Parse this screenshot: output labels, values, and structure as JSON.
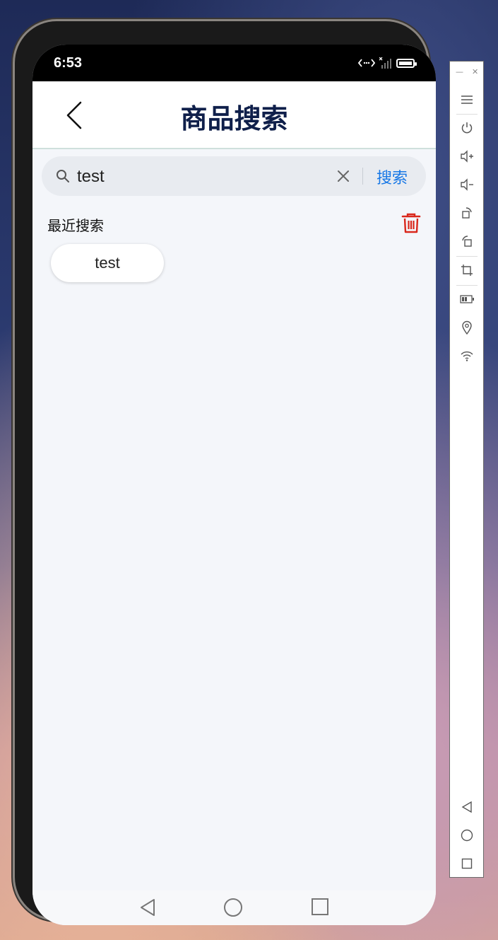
{
  "status_bar": {
    "time": "6:53"
  },
  "header": {
    "title": "商品搜索"
  },
  "search": {
    "value": "test",
    "button_label": "搜索"
  },
  "recent": {
    "label": "最近搜索",
    "items": [
      "test"
    ]
  },
  "icons": {
    "back": "chevron-left-icon",
    "search": "search-icon",
    "clear": "close-icon",
    "delete": "trash-icon"
  },
  "colors": {
    "title": "#0f1f4a",
    "accent": "#1677e6",
    "delete": "#d9281c",
    "background": "#f4f6fa"
  },
  "emulator_toolbar": {
    "window_controls": [
      "minimize",
      "close"
    ],
    "tools": [
      "menu",
      "power",
      "volume-up",
      "volume-down",
      "rotate",
      "rotate-alt",
      "screenshot-crop",
      "battery",
      "location",
      "wifi",
      "nav-back",
      "nav-home",
      "nav-recents"
    ]
  }
}
